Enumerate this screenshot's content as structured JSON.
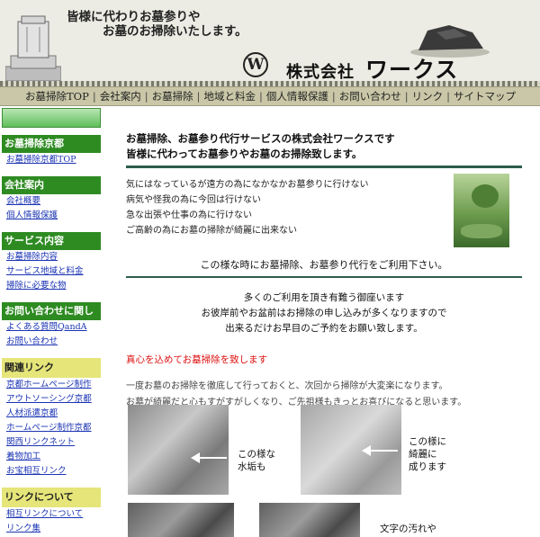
{
  "header": {
    "tagline_line1": "皆様に代わりお墓参りや",
    "tagline_line2": "お墓のお掃除いたします。",
    "logo_letter": "W",
    "company_prefix": "株式会社",
    "company_name": "ワークス"
  },
  "nav": {
    "items": [
      "お墓掃除TOP",
      "会社案内",
      "お墓掃除",
      "地域と料金",
      "個人情報保護",
      "お問い合わせ",
      "リンク",
      "サイトマップ"
    ]
  },
  "sidebar": {
    "sections": [
      {
        "title": "お墓掃除京都",
        "style": "green",
        "links": [
          "お墓掃除京都TOP"
        ]
      },
      {
        "title": "会社案内",
        "style": "green",
        "links": [
          "会社概要",
          "個人情報保護"
        ]
      },
      {
        "title": "サービス内容",
        "style": "green",
        "links": [
          "お墓掃除内容",
          "サービス地域と料金",
          "掃除に必要な物"
        ]
      },
      {
        "title": "お問い合わせに関して",
        "style": "green",
        "links": [
          "よくある質問QandA",
          "お問い合わせ"
        ]
      },
      {
        "title": "関連リンク",
        "style": "yellow",
        "links": [
          "京都ホームページ制作",
          "アウトソーシング京都",
          "人材派遣京都",
          "ホームページ制作京都",
          "関西リンクネット",
          "着物加工",
          "お宝相互リンク"
        ]
      },
      {
        "title": "リンクについて",
        "style": "yellow",
        "links": [
          "相互リンクについて",
          "リンク集"
        ]
      }
    ]
  },
  "main": {
    "title_line1": "お墓掃除、お墓参り代行サービスの株式会社ワークスです",
    "title_line2": "皆様に代わってお墓参りやお墓のお掃除致します。",
    "reasons": [
      "気にはなっているが遠方の為になかなかお墓参りに行けない",
      "病気や怪我の為に今回は行けない",
      "急な出張や仕事の為に行けない",
      "ご高齢の為にお墓の掃除が綺麗に出来ない"
    ],
    "call_to_action": "この様な時にお墓掃除、お墓参り代行をご利用下さい。",
    "gratitude": [
      "多くのご利用を頂き有難う御座います",
      "お彼岸前やお盆前はお掃除の申し込みが多くなりますので",
      "出来るだけお早目のご予約をお願い致します。"
    ],
    "red_heading": "真心を込めてお墓掃除を致します",
    "description": [
      "一度お墓のお掃除を徹底して行っておくと、次回から掃除が大変楽になります。",
      "お墓が綺麗だと心もすがすがしくなり、ご先祖様もきっとお喜びになると思います。"
    ],
    "figures": [
      {
        "caption": [
          "この様な",
          "水垢も"
        ]
      },
      {
        "caption": [
          "この様に",
          "綺麗に",
          "成ります"
        ]
      },
      {
        "caption": [
          "文字の汚れや"
        ]
      }
    ]
  }
}
